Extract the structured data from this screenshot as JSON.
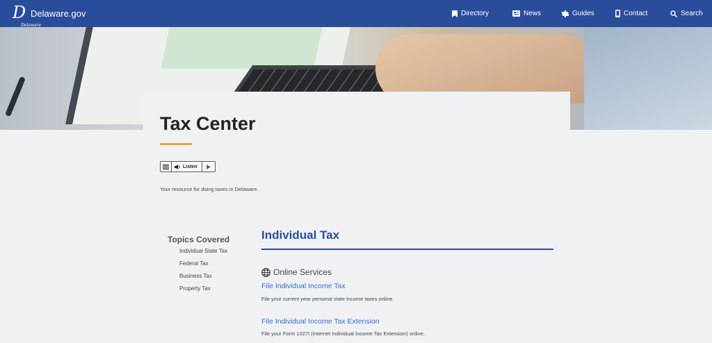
{
  "header": {
    "logo_letter": "D",
    "logo_small": "Delaware",
    "site_name": "Delaware.gov",
    "nav": [
      {
        "label": "Directory",
        "icon": "bookmark-icon"
      },
      {
        "label": "News",
        "icon": "newspaper-icon"
      },
      {
        "label": "Guides",
        "icon": "signpost-icon"
      },
      {
        "label": "Contact",
        "icon": "phone-icon"
      },
      {
        "label": "Search",
        "icon": "search-icon"
      }
    ],
    "color": "#2a4d9b"
  },
  "page": {
    "title": "Tax Center",
    "accent": "#e0a93a",
    "listen_label": "Listen",
    "intro": "Your resource for doing taxes in Delaware."
  },
  "topics": {
    "title": "Topics Covered",
    "items": [
      "Individual State Tax",
      "Federal Tax",
      "Business Tax",
      "Property Tax"
    ]
  },
  "section": {
    "title": "Individual Tax",
    "online_heading": "Online Services",
    "services": [
      {
        "link": "File Individual Income Tax",
        "desc": "File your current year personal state income taxes online."
      },
      {
        "link": "File Individual Income Tax Extension",
        "desc": "File your Form 1027I (Internet Individual Income Tax Extension) online."
      }
    ]
  }
}
